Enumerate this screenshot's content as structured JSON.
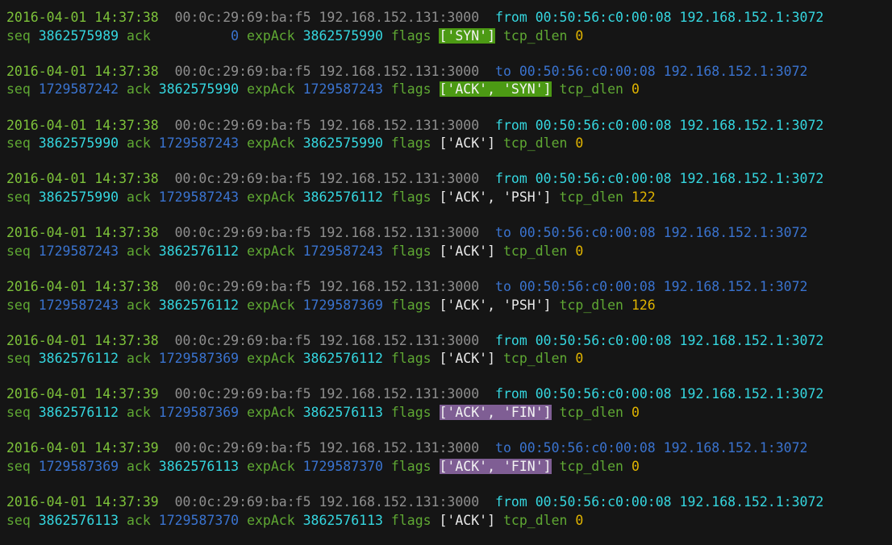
{
  "colors": {
    "background": "#151515",
    "timestamp": "#7dc23a",
    "address_dim": "#8e8e8e",
    "incoming": "#35d6df",
    "outgoing": "#3a73cf",
    "keyword": "#5fa833",
    "flags_text": "#e8e8e8",
    "length": "#e0b400",
    "syn_highlight": "#4c9a14",
    "fin_highlight": "#7f5e94"
  },
  "packets": [
    {
      "timestamp": "2016-04-01 14:37:38",
      "src_mac": "00:0c:29:69:ba:f5",
      "src_ip_port": "192.168.152.131:3000",
      "direction": "from",
      "direction_class": "in",
      "dst_mac": "00:50:56:c0:00:08",
      "dst_ip_port": "192.168.152.1:3072",
      "seq_label": "seq",
      "seq": "3862575989",
      "ack_label": "ack",
      "ack": "0",
      "expack_label": "expAck",
      "expack": "3862575990",
      "flags_label": "flags",
      "flags": "['SYN']",
      "flags_style": "syn",
      "dlen_label": "tcp_dlen",
      "dlen": "0"
    },
    {
      "timestamp": "2016-04-01 14:37:38",
      "src_mac": "00:0c:29:69:ba:f5",
      "src_ip_port": "192.168.152.131:3000",
      "direction": "to",
      "direction_class": "out",
      "dst_mac": "00:50:56:c0:00:08",
      "dst_ip_port": "192.168.152.1:3072",
      "seq_label": "seq",
      "seq": "1729587242",
      "ack_label": "ack",
      "ack": "3862575990",
      "expack_label": "expAck",
      "expack": "1729587243",
      "flags_label": "flags",
      "flags": "['ACK', 'SYN']",
      "flags_style": "syn",
      "dlen_label": "tcp_dlen",
      "dlen": "0"
    },
    {
      "timestamp": "2016-04-01 14:37:38",
      "src_mac": "00:0c:29:69:ba:f5",
      "src_ip_port": "192.168.152.131:3000",
      "direction": "from",
      "direction_class": "in",
      "dst_mac": "00:50:56:c0:00:08",
      "dst_ip_port": "192.168.152.1:3072",
      "seq_label": "seq",
      "seq": "3862575990",
      "ack_label": "ack",
      "ack": "1729587243",
      "expack_label": "expAck",
      "expack": "3862575990",
      "flags_label": "flags",
      "flags": "['ACK']",
      "flags_style": "plain",
      "dlen_label": "tcp_dlen",
      "dlen": "0"
    },
    {
      "timestamp": "2016-04-01 14:37:38",
      "src_mac": "00:0c:29:69:ba:f5",
      "src_ip_port": "192.168.152.131:3000",
      "direction": "from",
      "direction_class": "in",
      "dst_mac": "00:50:56:c0:00:08",
      "dst_ip_port": "192.168.152.1:3072",
      "seq_label": "seq",
      "seq": "3862575990",
      "ack_label": "ack",
      "ack": "1729587243",
      "expack_label": "expAck",
      "expack": "3862576112",
      "flags_label": "flags",
      "flags": "['ACK', 'PSH']",
      "flags_style": "plain",
      "dlen_label": "tcp_dlen",
      "dlen": "122"
    },
    {
      "timestamp": "2016-04-01 14:37:38",
      "src_mac": "00:0c:29:69:ba:f5",
      "src_ip_port": "192.168.152.131:3000",
      "direction": "to",
      "direction_class": "out",
      "dst_mac": "00:50:56:c0:00:08",
      "dst_ip_port": "192.168.152.1:3072",
      "seq_label": "seq",
      "seq": "1729587243",
      "ack_label": "ack",
      "ack": "3862576112",
      "expack_label": "expAck",
      "expack": "1729587243",
      "flags_label": "flags",
      "flags": "['ACK']",
      "flags_style": "plain",
      "dlen_label": "tcp_dlen",
      "dlen": "0"
    },
    {
      "timestamp": "2016-04-01 14:37:38",
      "src_mac": "00:0c:29:69:ba:f5",
      "src_ip_port": "192.168.152.131:3000",
      "direction": "to",
      "direction_class": "out",
      "dst_mac": "00:50:56:c0:00:08",
      "dst_ip_port": "192.168.152.1:3072",
      "seq_label": "seq",
      "seq": "1729587243",
      "ack_label": "ack",
      "ack": "3862576112",
      "expack_label": "expAck",
      "expack": "1729587369",
      "flags_label": "flags",
      "flags": "['ACK', 'PSH']",
      "flags_style": "plain",
      "dlen_label": "tcp_dlen",
      "dlen": "126"
    },
    {
      "timestamp": "2016-04-01 14:37:38",
      "src_mac": "00:0c:29:69:ba:f5",
      "src_ip_port": "192.168.152.131:3000",
      "direction": "from",
      "direction_class": "in",
      "dst_mac": "00:50:56:c0:00:08",
      "dst_ip_port": "192.168.152.1:3072",
      "seq_label": "seq",
      "seq": "3862576112",
      "ack_label": "ack",
      "ack": "1729587369",
      "expack_label": "expAck",
      "expack": "3862576112",
      "flags_label": "flags",
      "flags": "['ACK']",
      "flags_style": "plain",
      "dlen_label": "tcp_dlen",
      "dlen": "0"
    },
    {
      "timestamp": "2016-04-01 14:37:39",
      "src_mac": "00:0c:29:69:ba:f5",
      "src_ip_port": "192.168.152.131:3000",
      "direction": "from",
      "direction_class": "in",
      "dst_mac": "00:50:56:c0:00:08",
      "dst_ip_port": "192.168.152.1:3072",
      "seq_label": "seq",
      "seq": "3862576112",
      "ack_label": "ack",
      "ack": "1729587369",
      "expack_label": "expAck",
      "expack": "3862576113",
      "flags_label": "flags",
      "flags": "['ACK', 'FIN']",
      "flags_style": "fin",
      "dlen_label": "tcp_dlen",
      "dlen": "0"
    },
    {
      "timestamp": "2016-04-01 14:37:39",
      "src_mac": "00:0c:29:69:ba:f5",
      "src_ip_port": "192.168.152.131:3000",
      "direction": "to",
      "direction_class": "out",
      "dst_mac": "00:50:56:c0:00:08",
      "dst_ip_port": "192.168.152.1:3072",
      "seq_label": "seq",
      "seq": "1729587369",
      "ack_label": "ack",
      "ack": "3862576113",
      "expack_label": "expAck",
      "expack": "1729587370",
      "flags_label": "flags",
      "flags": "['ACK', 'FIN']",
      "flags_style": "fin",
      "dlen_label": "tcp_dlen",
      "dlen": "0"
    },
    {
      "timestamp": "2016-04-01 14:37:39",
      "src_mac": "00:0c:29:69:ba:f5",
      "src_ip_port": "192.168.152.131:3000",
      "direction": "from",
      "direction_class": "in",
      "dst_mac": "00:50:56:c0:00:08",
      "dst_ip_port": "192.168.152.1:3072",
      "seq_label": "seq",
      "seq": "3862576113",
      "ack_label": "ack",
      "ack": "1729587370",
      "expack_label": "expAck",
      "expack": "3862576113",
      "flags_label": "flags",
      "flags": "['ACK']",
      "flags_style": "plain",
      "dlen_label": "tcp_dlen",
      "dlen": "0"
    }
  ]
}
